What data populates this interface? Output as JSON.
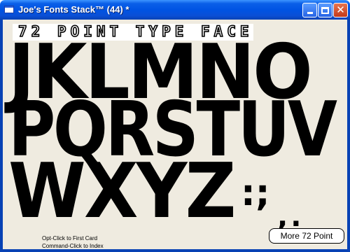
{
  "window": {
    "title": "Joe's Fonts Stack™ (44) *",
    "controls": {
      "minimize": "",
      "maximize": "",
      "close": "✕"
    }
  },
  "card": {
    "heading": "72 POINT TYPE FACE",
    "rows": [
      "JKLMNO",
      "PQRSTUV",
      "WXYZ"
    ],
    "punctuation_large": ":;",
    "punctuation_small": ",.",
    "hints": [
      "Opt-Click to First Card",
      "Command-Click to Index"
    ],
    "more_button": "More 72 Point"
  },
  "colors": {
    "titlebar": "#0054e3",
    "card_background": "#efebe0",
    "glyphs": "#000000"
  }
}
